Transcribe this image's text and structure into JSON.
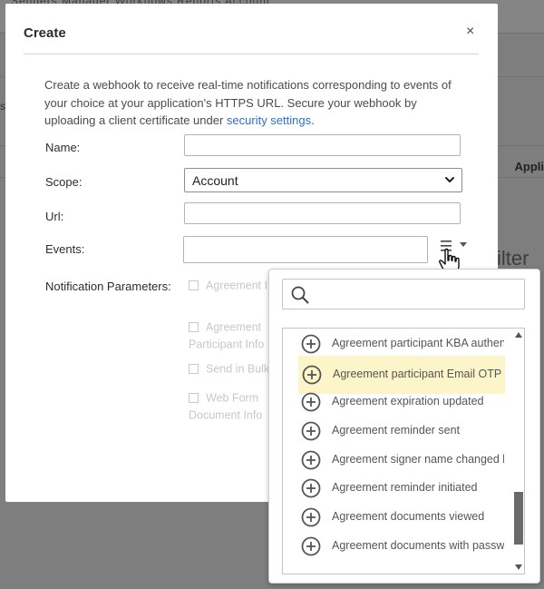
{
  "background": {
    "top_nav": "Senders Manager  Workflows  Reports  Account",
    "right_column_header": "Appli",
    "filter_text": "ilter",
    "left_edge_text": "s."
  },
  "modal": {
    "title": "Create",
    "close_label": "×",
    "intro_text": "Create a webhook to receive real-time notifications corresponding to events of your choice at your application's HTTPS URL. Secure your webhook by uploading a client certificate under ",
    "intro_link": "security settings",
    "intro_end": ".",
    "fields": {
      "name_label": "Name:",
      "name_value": "",
      "scope_label": "Scope:",
      "scope_value": "Account",
      "url_label": "Url:",
      "url_value": "",
      "events_label": "Events:",
      "events_value": "",
      "notification_label": "Notification Parameters:"
    },
    "notification_params": [
      {
        "label": "Agreement Info",
        "checked": false
      },
      {
        "label": "Agreement Participant Info",
        "checked": false
      },
      {
        "label": "Send in Bulk Info",
        "checked": false
      },
      {
        "label": "Web Form Document Info",
        "checked": false
      }
    ]
  },
  "events_popover": {
    "search_placeholder": "",
    "items": [
      {
        "label": "Agreement participant KBA authen...",
        "highlighted": false
      },
      {
        "label": "Agreement participant Email OTP a...",
        "highlighted": true
      },
      {
        "label": "Agreement expiration updated",
        "highlighted": false
      },
      {
        "label": "Agreement reminder sent",
        "highlighted": false
      },
      {
        "label": "Agreement signer name changed b...",
        "highlighted": false
      },
      {
        "label": "Agreement reminder initiated",
        "highlighted": false
      },
      {
        "label": "Agreement documents viewed",
        "highlighted": false
      },
      {
        "label": "Agreement documents with passw...",
        "highlighted": false
      }
    ]
  },
  "colors": {
    "overlay": "#7e7e7e",
    "link": "#2f6fc5",
    "highlight": "#fbf5c9"
  }
}
